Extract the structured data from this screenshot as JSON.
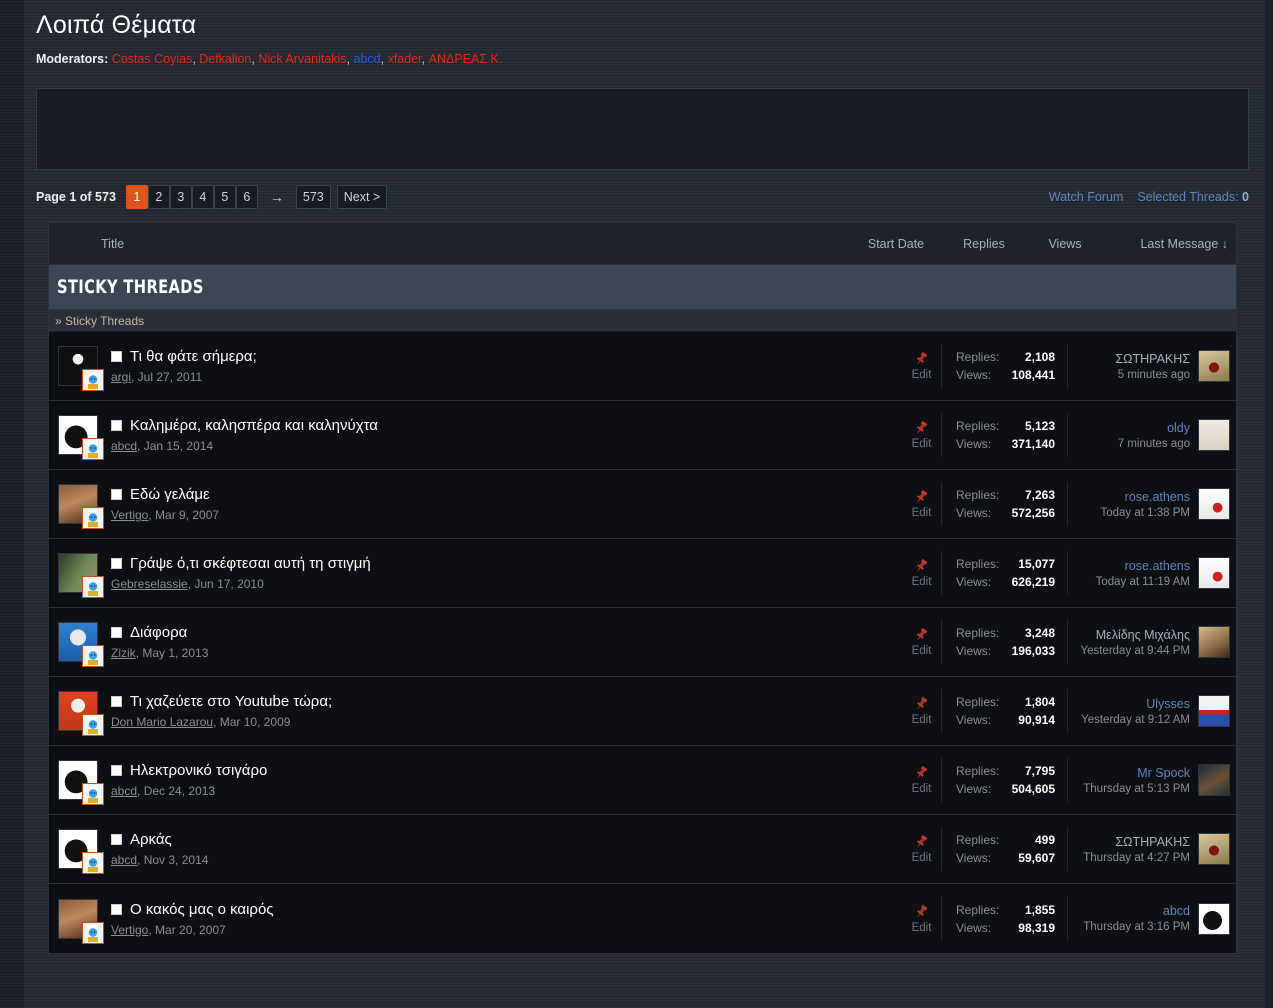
{
  "forum": {
    "title": "Λοιπά Θέματα",
    "moderators_label": "Moderators:",
    "moderators": [
      {
        "name": "Costas Coyias",
        "color": "red"
      },
      {
        "name": "Defkalion",
        "color": "red"
      },
      {
        "name": "Nick Arvanitakis",
        "color": "red"
      },
      {
        "name": "abcd",
        "color": "blue"
      },
      {
        "name": "xfader",
        "color": "red"
      },
      {
        "name": "ΑΝΔΡΕΑΣ Κ.",
        "color": "red"
      }
    ]
  },
  "pagenav": {
    "page_of": "Page 1 of 573",
    "pages": [
      "1",
      "2",
      "3",
      "4",
      "5",
      "6"
    ],
    "current": "1",
    "ellipsis": "→",
    "last_page": "573",
    "next_label": "Next >",
    "watch_forum": "Watch Forum",
    "selected_threads_label": "Selected Threads:",
    "selected_threads_count": "0"
  },
  "columns": {
    "title": "Title",
    "start_date": "Start Date",
    "replies": "Replies",
    "views": "Views",
    "last_message": "Last Message ↓"
  },
  "sections": {
    "sticky_banner": "Sticky Threads",
    "sticky_sub": "» Sticky Threads"
  },
  "labels": {
    "replies": "Replies:",
    "views": "Views:",
    "edit": "Edit"
  },
  "colors": {
    "accent_orange": "#e2521b",
    "link_blue": "#5e86b8",
    "mod_red": "#e02a16",
    "mod_blue": "#2b5fe0",
    "banner_blue": "#3c4756",
    "pin_red": "#c0392b"
  },
  "threads": [
    {
      "title": "Τι θα φάτε σήμερα;",
      "author": "argi",
      "date": "Jul 27, 2011",
      "replies": "2,108",
      "views": "108,441",
      "last_user": "ΣΩΤΗΡΑΚΗΣ",
      "last_user_style": "grey",
      "last_time": "5 minutes ago",
      "avatar_css": "radial-gradient(circle at 50% 32%, #f4f4f4 0 16%, #111 17% 100%), linear-gradient(#0a0a0a,#0a0a0a)",
      "last_avatar_css": "radial-gradient(circle at 50% 55%, #7d1414 0 22%, transparent 23%), linear-gradient(160deg,#d9c8a0,#8d7a4e)"
    },
    {
      "title": "Καλημέρα, καλησπέρα και καληνύχτα",
      "author": "abcd",
      "date": "Jan 15, 2014",
      "replies": "5,123",
      "views": "371,140",
      "last_user": "oldy",
      "last_user_style": "blue",
      "last_time": "7 minutes ago",
      "avatar_css": "radial-gradient(ellipse at 45% 55%, #111 0 38%, #fff 39% 100%)",
      "last_avatar_css": "linear-gradient(#efece3,#d8d2c2)"
    },
    {
      "title": "Εδώ γελάμε",
      "author": "Vertigo",
      "date": "Mar 9, 2007",
      "replies": "7,263",
      "views": "572,256",
      "last_user": "rose.athens",
      "last_user_style": "blue",
      "last_time": "Today at 1:38 PM",
      "avatar_css": "linear-gradient(160deg,#8a5a3a,#c08a5e 45%,#4a2a18)",
      "last_avatar_css": "radial-gradient(circle at 62% 62%, #cc2020 0 18%, transparent 19%), linear-gradient(#fdfdfd,#e8e8e8)"
    },
    {
      "title": "Γράψε ό,τι σκέφτεσαι αυτή τη στιγμή",
      "author": "Gebreselassie",
      "date": "Jun 17, 2010",
      "replies": "15,077",
      "views": "626,219",
      "last_user": "rose.athens",
      "last_user_style": "blue",
      "last_time": "Today at 11:19 AM",
      "avatar_css": "linear-gradient(120deg,#2c3a22,#6d8a5a 55%,#b08a64)",
      "last_avatar_css": "radial-gradient(circle at 62% 62%, #cc2020 0 18%, transparent 19%), linear-gradient(#fdfdfd,#e8e8e8)"
    },
    {
      "title": "Διάφορα",
      "author": "Zizik",
      "date": "May 1, 2013",
      "replies": "3,248",
      "views": "196,033",
      "last_user": "Μελίδης Μιχάλης",
      "last_user_style": "grey",
      "last_time": "Yesterday at 9:44 PM",
      "avatar_css": "radial-gradient(circle at 50% 38%, #e8e8e8 0 26%, transparent 27%), linear-gradient(#2f7fd0,#1a5fa8)",
      "last_avatar_css": "linear-gradient(150deg,#d8b98a,#8a6a48 60%,#3a2a1a)"
    },
    {
      "title": "Τι χαζεύετε στο Youtube τώρα;",
      "author": "Don Mario Lazarou",
      "date": "Mar 10, 2009",
      "replies": "1,804",
      "views": "90,914",
      "last_user": "Ulysses",
      "last_user_style": "blue",
      "last_time": "Yesterday at 9:12 AM",
      "avatar_css": "radial-gradient(circle at 50% 36%, #f0f0f0 0 22%, transparent 23%), linear-gradient(#d9441f,#c13a1a)",
      "last_avatar_css": "linear-gradient(#f2f2f2 0 46%, #c92020 46% 62%, #2b4fa8 62% 100%)"
    },
    {
      "title": "Ηλεκτρονικό τσιγάρο",
      "author": "abcd",
      "date": "Dec 24, 2013",
      "replies": "7,795",
      "views": "504,605",
      "last_user": "Mr Spock",
      "last_user_style": "blue",
      "last_time": "Thursday at 5:13 PM",
      "avatar_css": "radial-gradient(ellipse at 45% 55%, #111 0 38%, #fff 39% 100%)",
      "last_avatar_css": "linear-gradient(150deg,#1d2c38,#6a5038 55%,#23323c)"
    },
    {
      "title": "Αρκάς",
      "author": "abcd",
      "date": "Nov 3, 2014",
      "replies": "499",
      "views": "59,607",
      "last_user": "ΣΩΤΗΡΑΚΗΣ",
      "last_user_style": "grey",
      "last_time": "Thursday at 4:27 PM",
      "avatar_css": "radial-gradient(ellipse at 45% 55%, #111 0 38%, #fff 39% 100%)",
      "last_avatar_css": "radial-gradient(circle at 50% 55%, #7d1414 0 22%, transparent 23%), linear-gradient(160deg,#d9c8a0,#8d7a4e)"
    },
    {
      "title": "Ο κακός μας ο καιρός",
      "author": "Vertigo",
      "date": "Mar 20, 2007",
      "replies": "1,855",
      "views": "98,319",
      "last_user": "abcd",
      "last_user_style": "blue",
      "last_time": "Thursday at 3:16 PM",
      "avatar_css": "linear-gradient(160deg,#8a5a3a,#c08a5e 45%,#4a2a18)",
      "last_avatar_css": "radial-gradient(ellipse at 45% 55%, #111 0 40%, #fff 41% 100%)"
    }
  ]
}
